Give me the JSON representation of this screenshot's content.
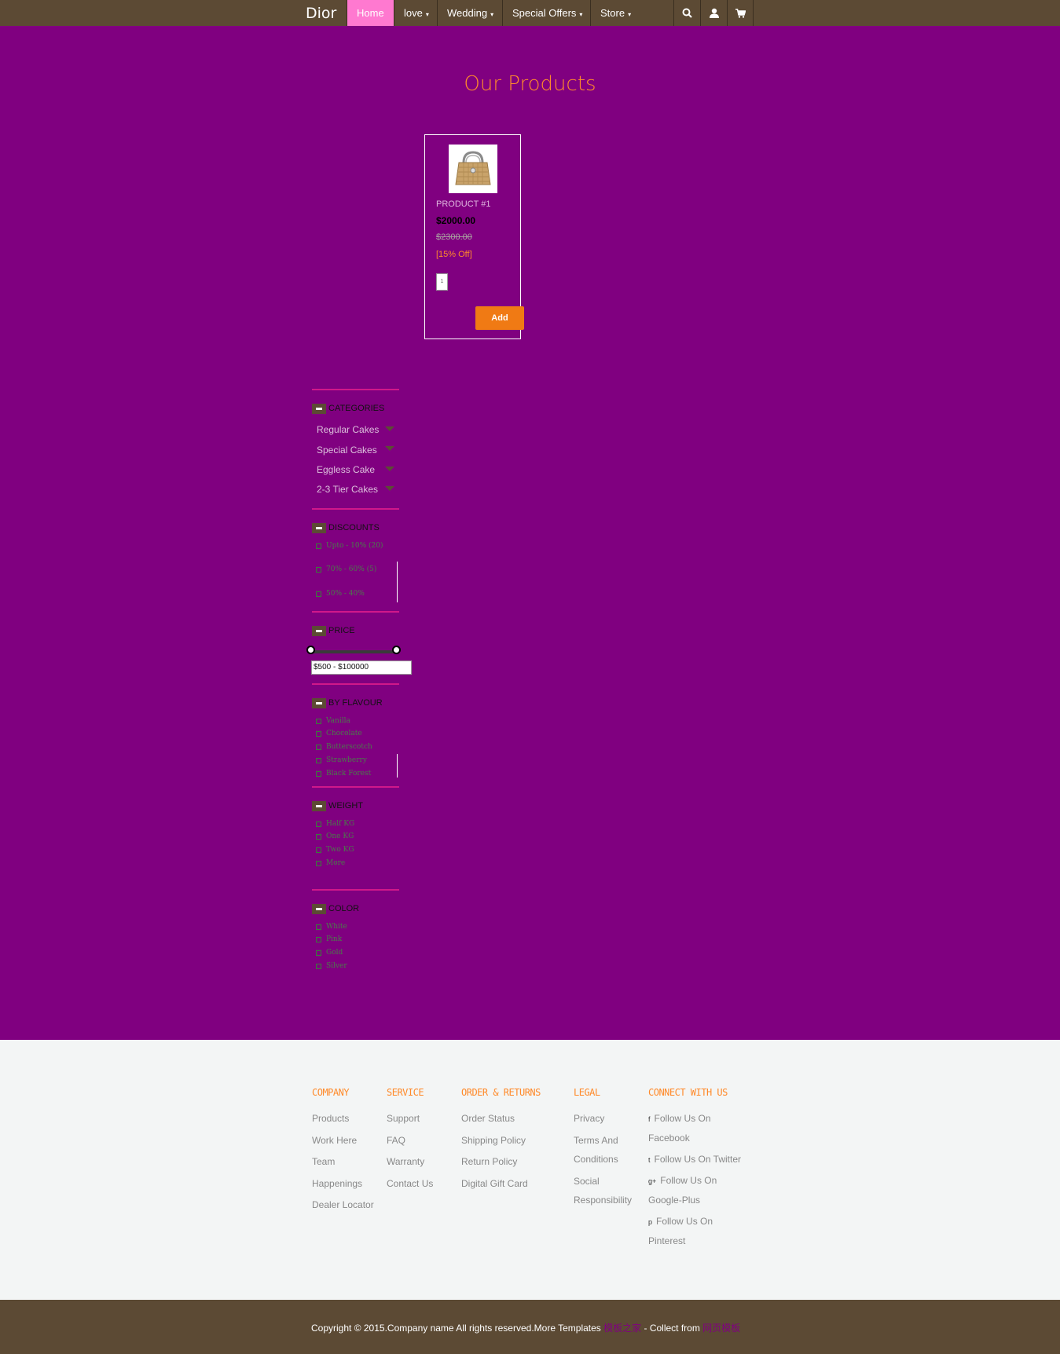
{
  "nav": {
    "brand": "Dior",
    "items": [
      {
        "label": "Home",
        "caret": ""
      },
      {
        "label": "love",
        "caret": "▾"
      },
      {
        "label": "Wedding",
        "caret": "▾"
      },
      {
        "label": "Special Offers",
        "caret": "▾"
      },
      {
        "label": "Store",
        "caret": "▾"
      }
    ],
    "active_color": "#ff79d0",
    "bar_color": "#5c4a34",
    "icons": [
      "search-icon",
      "user-icon",
      "cart-icon"
    ]
  },
  "main": {
    "title": "Our Products",
    "product": {
      "image": "handbag-image",
      "name": "PRODUCT #1",
      "price": "$2000.00",
      "old_price": "$2300.00",
      "discount": "[15% Off]",
      "qty": "1",
      "add_label": "Add"
    }
  },
  "sidebar": {
    "categories": {
      "label": "CATEGORIES",
      "items": [
        "Regular Cakes",
        "Special Cakes",
        "Eggless Cake",
        "2-3 Tier Cakes"
      ]
    },
    "discounts": {
      "label": "DISCOUNTS",
      "items": [
        "Upto - 10% (20)",
        "70% - 60% (5)",
        "50% - 40%"
      ]
    },
    "price": {
      "label": "PRICE",
      "range_value": "$500 - $100000"
    },
    "flavour": {
      "label": "BY FLAVOUR",
      "items": [
        "Vanilla",
        "Chocolate",
        "Butterscotch",
        "Strawberry",
        "Black Forest"
      ]
    },
    "weight": {
      "label": "WEIGHT",
      "items": [
        "Half KG",
        "One KG",
        "Two KG",
        "More"
      ]
    },
    "color": {
      "label": "COLOR",
      "items": [
        "White",
        "Pink",
        "Gold",
        "Silver"
      ]
    }
  },
  "footer": {
    "columns": [
      {
        "heading": "COMPANY",
        "links": [
          "Products",
          "Work Here",
          "Team",
          "Happenings",
          "Dealer Locator"
        ]
      },
      {
        "heading": "SERVICE",
        "links": [
          "Support",
          "FAQ",
          "Warranty",
          "Contact Us"
        ]
      },
      {
        "heading": "ORDER & RETURNS",
        "links": [
          "Order Status",
          "Shipping Policy",
          "Return Policy",
          "Digital Gift Card"
        ]
      },
      {
        "heading": "LEGAL",
        "links": [
          "Privacy",
          "Terms And Conditions",
          "Social Responsibility"
        ]
      },
      {
        "heading": "CONNECT WITH US",
        "links": [
          {
            "icon": "facebook-icon",
            "glyph": "f",
            "label": "Follow Us On Facebook"
          },
          {
            "icon": "twitter-icon",
            "glyph": "t",
            "label": "Follow Us On Twitter"
          },
          {
            "icon": "google-plus-icon",
            "glyph": "g+",
            "label": "Follow Us On Google-Plus"
          },
          {
            "icon": "pinterest-icon",
            "glyph": "p",
            "label": "Follow Us On Pinterest"
          }
        ]
      }
    ],
    "copyright": {
      "text": "Copyright © 2015.Company name All rights reserved.More Templates",
      "link1": "模板之家",
      "middle": " - Collect from ",
      "link2": "网页模板"
    }
  }
}
